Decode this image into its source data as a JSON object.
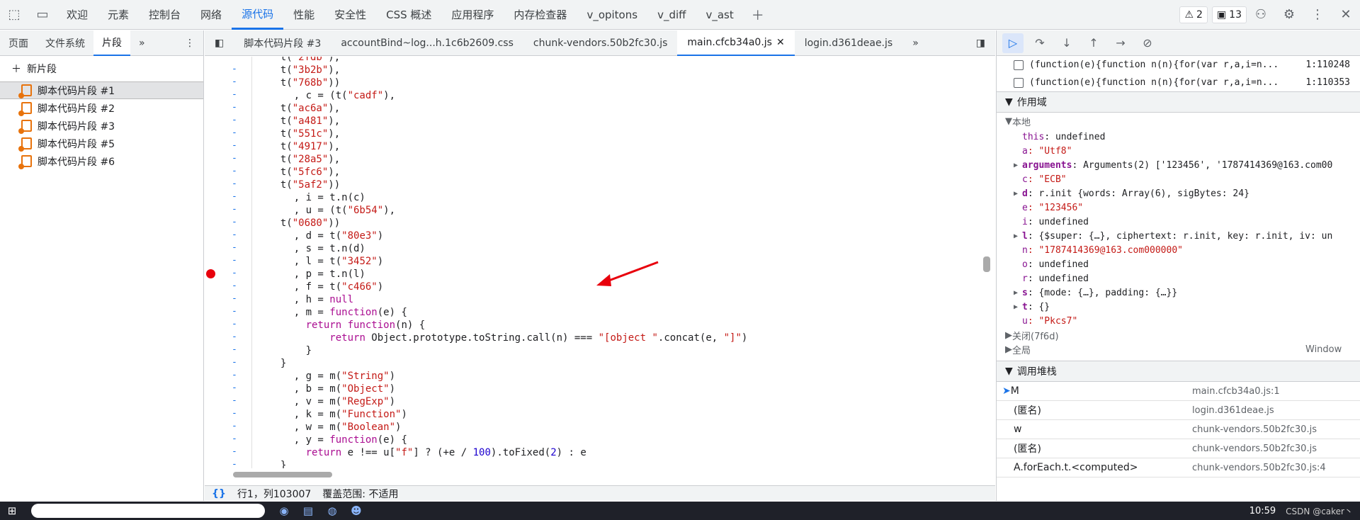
{
  "topbar": {
    "tabs": [
      "欢迎",
      "元素",
      "控制台",
      "网络",
      "源代码",
      "性能",
      "安全性",
      "CSS 概述",
      "应用程序",
      "内存检查器",
      "v_opitons",
      "v_diff",
      "v_ast"
    ],
    "active": "源代码",
    "warn_count": "2",
    "msg_count": "13"
  },
  "left": {
    "subtabs": [
      "页面",
      "文件系统",
      "片段"
    ],
    "active": "片段",
    "new_label": "新片段",
    "files": [
      "脚本代码片段 #1",
      "脚本代码片段 #2",
      "脚本代码片段 #3",
      "脚本代码片段 #5",
      "脚本代码片段 #6"
    ]
  },
  "editor": {
    "tabs": [
      "脚本代码片段 #3",
      "accountBind~log...h.1c6b2609.css",
      "chunk-vendors.50b2fc30.js",
      "main.cfcb34a0.js",
      "login.d361deae.js"
    ],
    "active": "main.cfcb34a0.js",
    "lines": [
      [
        "t(\"2fdb\"),"
      ],
      [
        "t(\"3b2b\"),"
      ],
      [
        "t(\"768b\"))"
      ],
      [
        "  , c = (t(\"cadf\"),"
      ],
      [
        "t(\"ac6a\"),"
      ],
      [
        "t(\"a481\"),"
      ],
      [
        "t(\"551c\"),"
      ],
      [
        "t(\"4917\"),"
      ],
      [
        "t(\"28a5\"),"
      ],
      [
        "t(\"5fc6\"),"
      ],
      [
        "t(\"5af2\"))"
      ],
      [
        "  , i = t.n(c)"
      ],
      [
        "  , u = (t(\"6b54\"),"
      ],
      [
        "t(\"0680\"))"
      ],
      [
        "  , d = t(\"80e3\")"
      ],
      [
        "  , s = t.n(d)"
      ],
      [
        "  , l = t(\"3452\")"
      ],
      [
        "  , p = t.n(l)"
      ],
      [
        "  , f = t(\"c466\")"
      ],
      [
        "  , h = null"
      ],
      [
        "  , m = function(e) {"
      ],
      [
        "    return function(n) {"
      ],
      [
        "        return Object.prototype.toString.call(n) === \"[object \".concat(e, \"]\")"
      ],
      [
        "    }"
      ],
      [
        "}"
      ],
      [
        "  , g = m(\"String\")"
      ],
      [
        "  , b = m(\"Object\")"
      ],
      [
        "  , v = m(\"RegExp\")"
      ],
      [
        "  , k = m(\"Function\")"
      ],
      [
        "  , w = m(\"Boolean\")"
      ],
      [
        "  , y = function(e) {"
      ],
      [
        "    return e !== u[\"f\"] ? (+e / 100).toFixed(2) : e"
      ],
      [
        "}"
      ]
    ],
    "status_pos": "行1，列103007",
    "status_cov": "覆盖范围: 不适用"
  },
  "right": {
    "breakpoints": [
      [
        "(function(e){function n(n){for(var r,a,i=n...",
        "1:110248"
      ],
      [
        "(function(e){function n(n){for(var r,a,i=n...",
        "1:110353"
      ]
    ],
    "scope_title": "作用域",
    "local_title": "本地",
    "vars": [
      [
        "this",
        ": undefined",
        ""
      ],
      [
        "a",
        ": \"Utf8\"",
        "s"
      ],
      [
        "arguments",
        ": Arguments(2) ['123456', '1787414369@163.com00",
        ""
      ],
      [
        "c",
        ": \"ECB\"",
        "s"
      ],
      [
        "d",
        ": r.init {words: Array(6), sigBytes: 24}",
        ""
      ],
      [
        "e",
        ": \"123456\"",
        "s"
      ],
      [
        "i",
        ": undefined",
        ""
      ],
      [
        "l",
        ": {$super: {…}, ciphertext: r.init, key: r.init, iv: un",
        ""
      ],
      [
        "n",
        ": \"1787414369@163.com000000\"",
        "s"
      ],
      [
        "o",
        ": undefined",
        ""
      ],
      [
        "r",
        ": undefined",
        ""
      ],
      [
        "s",
        ": {mode: {…}, padding: {…}}",
        ""
      ],
      [
        "t",
        ": {}",
        ""
      ],
      [
        "u",
        ": \"Pkcs7\"",
        "s"
      ]
    ],
    "closure": "关闭(7f6d)",
    "global": "全局",
    "global_val": "Window",
    "callstack_title": "调用堆栈",
    "calls": [
      [
        "M",
        "main.cfcb34a0.js:1"
      ],
      [
        "(匿名)",
        "login.d361deae.js"
      ],
      [
        "w",
        "chunk-vendors.50b2fc30.js"
      ],
      [
        "(匿名)",
        "chunk-vendors.50b2fc30.js"
      ],
      [
        "A.forEach.t.<computed>",
        "chunk-vendors.50b2fc30.js:4"
      ]
    ]
  },
  "taskbar": {
    "time": "10:59",
    "csdn": "CSDN @caker丶"
  }
}
